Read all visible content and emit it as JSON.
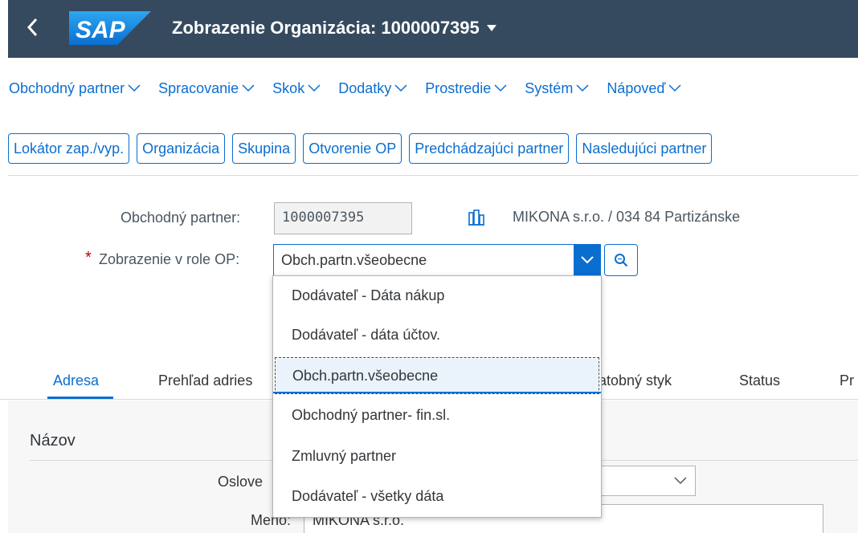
{
  "shell": {
    "title": "Zobrazenie Organizácia: 1000007395",
    "logo_text": "SAP",
    "colors": {
      "shell_bg": "#354a5f",
      "logo_blue": "#1b8ae0",
      "accent": "#0a6ed1"
    }
  },
  "menu": [
    {
      "label": "Obchodný partner"
    },
    {
      "label": "Spracovanie"
    },
    {
      "label": "Skok"
    },
    {
      "label": "Dodatky"
    },
    {
      "label": "Prostredie"
    },
    {
      "label": "Systém"
    },
    {
      "label": "Nápoveď"
    }
  ],
  "toolbar": [
    {
      "label": "Lokátor zap./vyp."
    },
    {
      "label": "Organizácia"
    },
    {
      "label": "Skupina"
    },
    {
      "label": "Otvorenie OP"
    },
    {
      "label": "Predchádzajúci partner"
    },
    {
      "label": "Nasledujúci partner"
    }
  ],
  "form": {
    "partner_label": "Obchodný partner:",
    "partner_value": "1000007395",
    "partner_desc": "MIKONA s.r.o. / 034 84 Partizánske",
    "required_mark": "*",
    "role_label": "Zobrazenie v role OP:",
    "role_value": "Obch.partn.všeobecne"
  },
  "dropdown": {
    "options": [
      {
        "label": "Dodávateľ - Dáta nákup"
      },
      {
        "label": "Dodávateľ - dáta účtov."
      },
      {
        "label": "Obch.partn.všeobecne"
      },
      {
        "label": "Obchodný partner- fin.sl."
      },
      {
        "label": "Zmluvný partner"
      },
      {
        "label": "Dodávateľ - všetky dáta"
      }
    ],
    "selected_index": 2
  },
  "tabs": [
    {
      "label": "Adresa",
      "active": true
    },
    {
      "label": "Prehľad adries",
      "active": false
    },
    {
      "label": "atobný styk",
      "active": false
    },
    {
      "label": "Status",
      "active": false
    },
    {
      "label": "Pr",
      "active": false
    }
  ],
  "section": {
    "title": "Názov",
    "salutation_label": "Oslove",
    "name_label": "Meno:",
    "name_value": "MIKONA s.r.o."
  }
}
